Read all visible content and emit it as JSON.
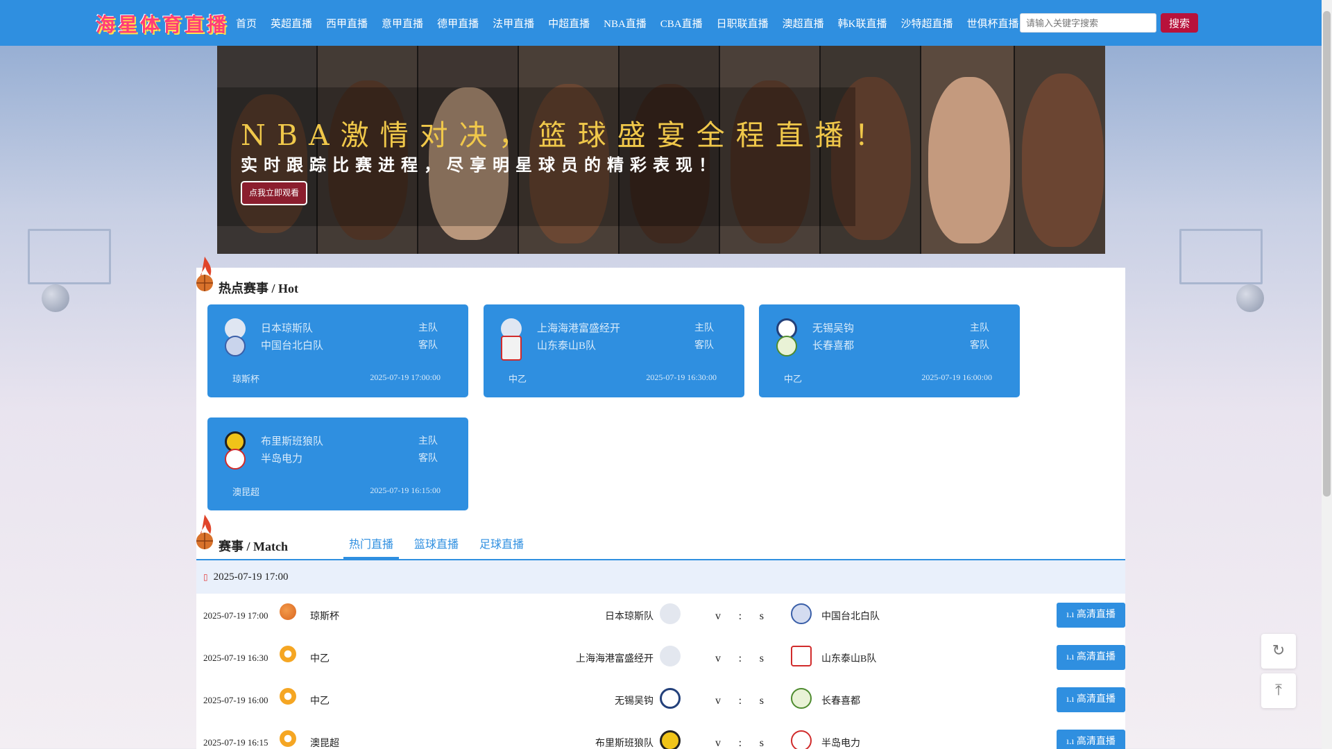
{
  "header": {
    "logo_text": "海星体育直播",
    "nav": [
      "首页",
      "英超直播",
      "西甲直播",
      "意甲直播",
      "德甲直播",
      "法甲直播",
      "中超直播",
      "NBA直播",
      "CBA直播",
      "日职联直播",
      "澳超直播",
      "韩K联直播",
      "沙特超直播",
      "世俱杯直播"
    ],
    "search_placeholder": "请输入关键字搜索",
    "search_button": "搜索"
  },
  "banner": {
    "title": "NBA激情对决，篮球盛宴全程直播！",
    "subtitle": "实时跟踪比赛进程，尽享明星球员的精彩表现！",
    "button": "点我立即观看"
  },
  "hot": {
    "title": "热点赛事 / Hot",
    "home_label": "主队",
    "away_label": "客队",
    "cards": [
      {
        "home": "日本琼斯队",
        "away": "中国台北白队",
        "league": "琼斯杯",
        "time": "2025-07-19 17:00:00"
      },
      {
        "home": "上海海港富盛经开",
        "away": "山东泰山B队",
        "league": "中乙",
        "time": "2025-07-19 16:30:00"
      },
      {
        "home": "无锡吴钩",
        "away": "长春喜都",
        "league": "中乙",
        "time": "2025-07-19 16:00:00"
      },
      {
        "home": "布里斯班狼队",
        "away": "半岛电力",
        "league": "澳昆超",
        "time": "2025-07-19 16:15:00"
      }
    ]
  },
  "match": {
    "title": "赛事 / Match",
    "tabs": [
      "热门直播",
      "篮球直播",
      "足球直播"
    ],
    "date_header": "2025-07-19 17:00",
    "live_label": "高清直播",
    "rows": [
      {
        "time": "2025-07-19 17:00",
        "sport": "basketball",
        "league": "琼斯杯",
        "home": "日本琼斯队",
        "away": "中国台北白队",
        "v": "v",
        "colon": ":",
        "s": "s"
      },
      {
        "time": "2025-07-19 16:30",
        "sport": "football",
        "league": "中乙",
        "home": "上海海港富盛经开",
        "away": "山东泰山B队",
        "v": "v",
        "colon": ":",
        "s": "s"
      },
      {
        "time": "2025-07-19 16:00",
        "sport": "football",
        "league": "中乙",
        "home": "无锡吴钩",
        "away": "长春喜都",
        "v": "v",
        "colon": ":",
        "s": "s"
      },
      {
        "time": "2025-07-19 16:15",
        "sport": "football",
        "league": "澳昆超",
        "home": "布里斯班狼队",
        "away": "半岛电力",
        "v": "v",
        "colon": ":",
        "s": "s"
      }
    ]
  },
  "colors": {
    "primary": "#2f8fe0",
    "search_button": "#b8123b",
    "banner_title": "#f0c84a"
  }
}
